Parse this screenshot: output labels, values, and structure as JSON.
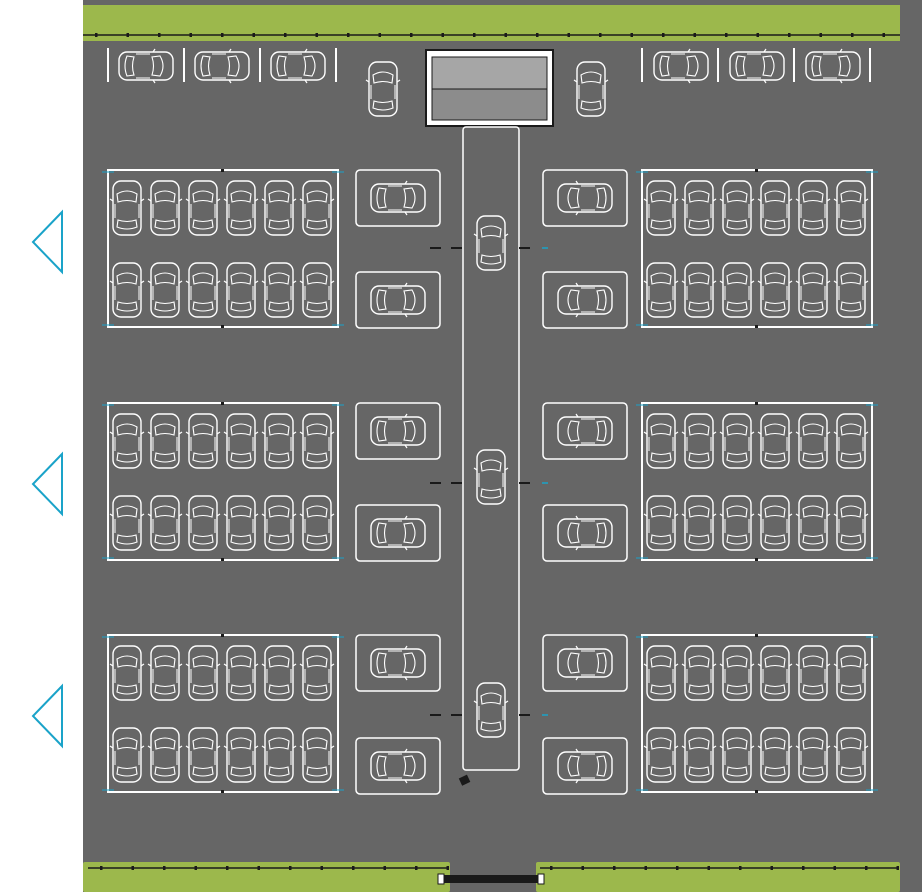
{
  "colors": {
    "asphalt": "#666666",
    "grass": "#9cb84c",
    "line": "#ffffff",
    "arrow": "#1aa3c9",
    "building_top": "#a6a6a6",
    "building_bottom": "#8c8c8c",
    "dark": "#1a1a1a"
  },
  "icons": {
    "direction_arrow": "left-chevron-arrow-icon",
    "car": "car-top-view-icon"
  },
  "lot": {
    "parking_blocks": 6,
    "cars_per_row": 6,
    "rows_per_block": 2,
    "side_slots_per_block": 2,
    "lane_cars": 3,
    "entry_arrows": 3,
    "top_left_cars": 3,
    "top_right_cars": 3
  }
}
